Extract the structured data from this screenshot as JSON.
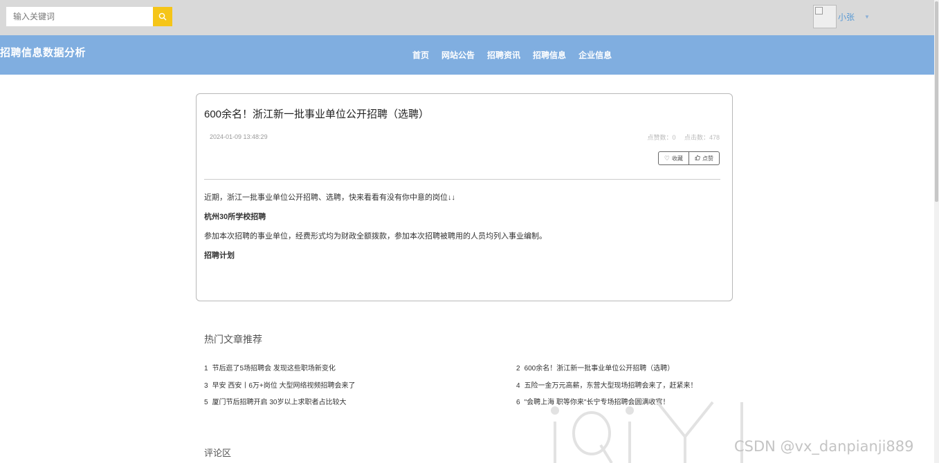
{
  "search": {
    "placeholder": "输入关键词",
    "button_icon": "search-icon"
  },
  "user": {
    "name": "小张",
    "caret_icon": "caret-down-icon"
  },
  "header": {
    "site_title": "招聘信息数据分析",
    "nav": [
      "首页",
      "网站公告",
      "招聘资讯",
      "招聘信息",
      "企业信息"
    ]
  },
  "article": {
    "title": "600余名！浙江新一批事业单位公开招聘（选聘）",
    "date": "2024-01-09 13:48:29",
    "likes_text": "点赞数：0",
    "clicks_text": "点击数：478",
    "favorite_label": "收藏",
    "like_label": "点赞",
    "paragraphs": [
      "近期，浙江一批事业单位公开招聘、选聘，快来看看有没有你中意的岗位↓↓",
      "杭州30所学校招聘",
      "参加本次招聘的事业单位，经费形式均为财政全额拨款，参加本次招聘被聘用的人员均列入事业编制。",
      "招聘计划"
    ]
  },
  "hot": {
    "title": "热门文章推荐",
    "items": [
      {
        "num": "1",
        "text": "节后逛了5场招聘会 发现这些职场新变化"
      },
      {
        "num": "2",
        "text": "600余名！浙江新一批事业单位公开招聘（选聘）"
      },
      {
        "num": "3",
        "text": "早安 西安丨6万+岗位 大型网络视频招聘会来了"
      },
      {
        "num": "4",
        "text": "五险一金万元高薪，东营大型现场招聘会来了，赶紧来！"
      },
      {
        "num": "5",
        "text": "厦门节后招聘开启 30岁以上求职者占比较大"
      },
      {
        "num": "6",
        "text": "\"会聘上海 职等你来\"长宁专场招聘会圆满收官！"
      }
    ]
  },
  "comments": {
    "title": "评论区"
  },
  "watermark": {
    "text": "CSDN @vx_danpianji889",
    "logo_text": "iQIYI"
  },
  "colors": {
    "nav_bg": "#80aee0",
    "topbar_bg": "#d9d9d9",
    "search_button": "#f5c518",
    "user_link": "#5b9bd5"
  }
}
